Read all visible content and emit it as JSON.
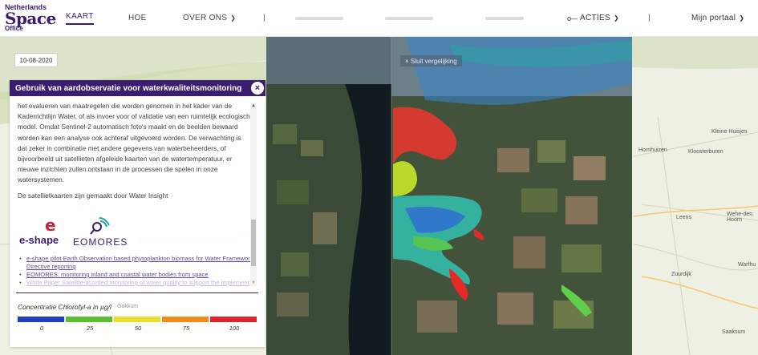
{
  "logo": {
    "line1": "Netherlands",
    "line2": "Space",
    "line3": "Office"
  },
  "nav": {
    "kaart": "KAART",
    "hoe": "HOE",
    "over_ons": "OVER ONS",
    "separator": "|",
    "acties": "ACTIES",
    "portaal": "Mijn portaal"
  },
  "map": {
    "date": "10-08-2020",
    "compare_label": "× Sluit vergelijking",
    "place_labels": [
      "Kleine Huisjes",
      "Hornhuizen",
      "Kloosterburen",
      "Wehe-den Hoorn",
      "Leens",
      "Zuurdijk",
      "Warfhu",
      "Saaksum",
      "Gokkum"
    ]
  },
  "panel": {
    "title": "Gebruik van aardobservatie voor waterkwaliteitsmonitoring",
    "close": "×",
    "paragraph": "het evalueren van maatregelen die worden genomen in het kader van de Kaderrichtlijn Water, of als invoer voor of validatie van een ruimtelijk ecologisch model. Omdat Sentinel-2 automatisch foto's maakt en de beelden bewaard worden kan een analyse ook achteraf uitgevoerd worden. De verwachting is dat zeker in combinatie met andere gegevens van waterbeheerders, of bijvoorbeeld uit satellieten afgeleide kaarten van de watertemperatuur, er nieuwe inzichten zullen ontstaan in de processen die spelen in onze watersystemen.",
    "credit": "De satellietkaarten zijn gemaakt door Water Insight",
    "logos": {
      "eshape": "e-shape",
      "eshape_mark": "e",
      "eomores": "EOMORES"
    },
    "links": [
      "e-shape pilot Earth Observation based phytoplankton biomass for Water Framework Directive reporting",
      "EOMORES: monitoring inland and coastal water bodies from space",
      "White Paper Satellite-assisted monitoring of water quality to support the implement"
    ],
    "legend": {
      "title": "Concentratie Chlorofyl-a in µg/l",
      "ticks": [
        "0",
        "25",
        "50",
        "75",
        "100"
      ],
      "colors": [
        "#1f3fbf",
        "#5bbf34",
        "#eedf2f",
        "#f28a1c",
        "#e0242d"
      ]
    }
  },
  "colors": {
    "brand": "#3a1d6e"
  }
}
